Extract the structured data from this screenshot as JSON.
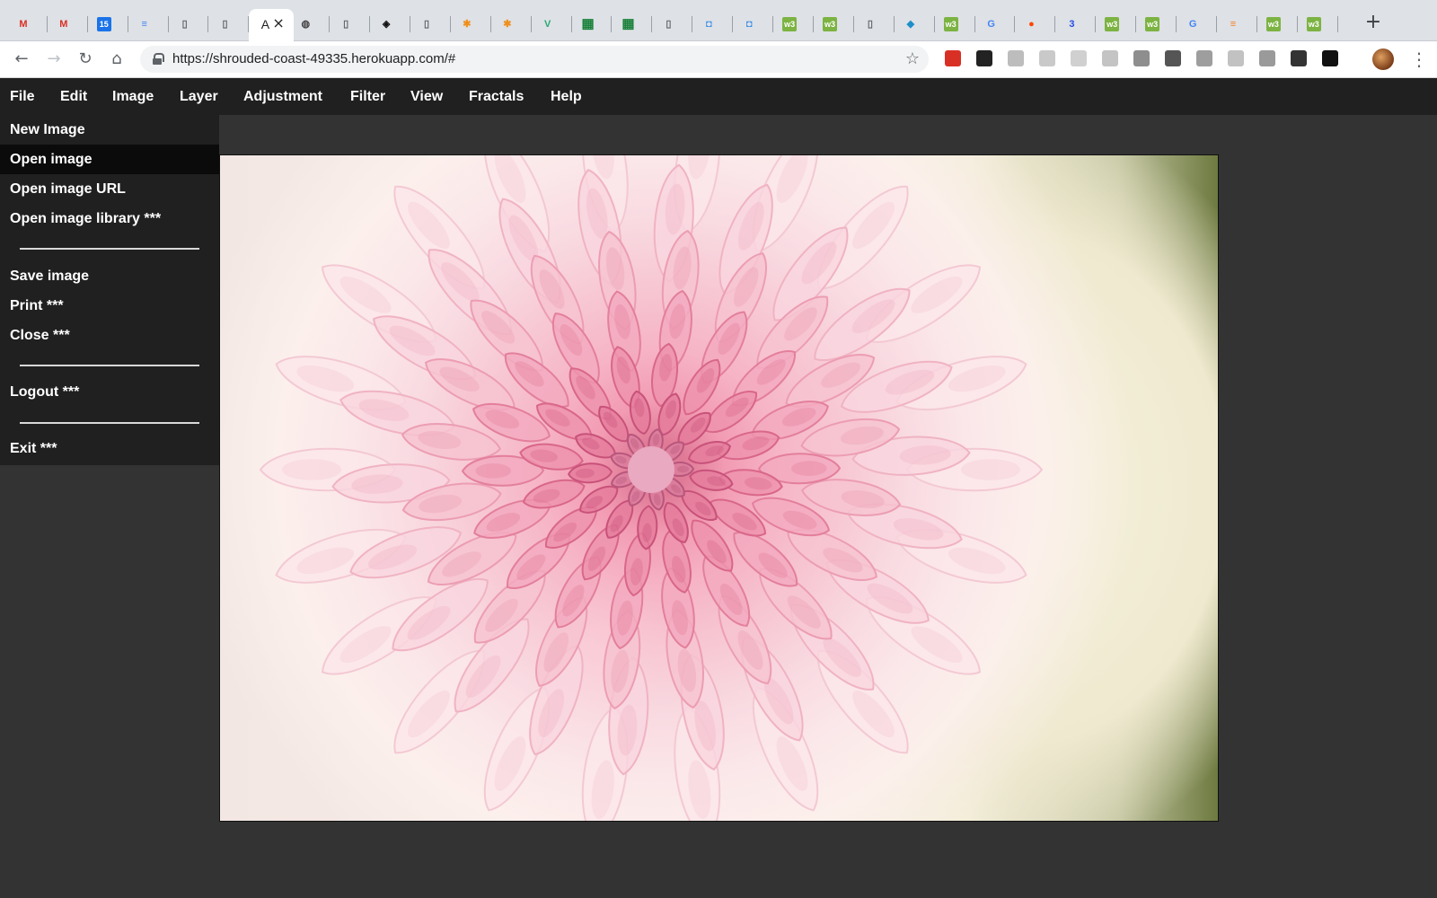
{
  "browser": {
    "tabs": [
      {
        "icon": "gmail-icon",
        "glyph": "M",
        "color": "#d93025"
      },
      {
        "icon": "gmail-icon",
        "glyph": "M",
        "color": "#d93025"
      },
      {
        "icon": "calendar-icon",
        "glyph": "15",
        "color": "#1a73e8"
      },
      {
        "icon": "docs-icon",
        "glyph": "≡",
        "color": "#4285f4"
      },
      {
        "icon": "page-icon",
        "glyph": "▯",
        "color": "#5f6368"
      },
      {
        "icon": "page-icon",
        "glyph": "▯",
        "color": "#5f6368"
      },
      {
        "icon": "active-tab-icon",
        "glyph": "A",
        "color": "#202124"
      },
      {
        "icon": "dribbble-icon",
        "glyph": "◍",
        "color": "#444444"
      },
      {
        "icon": "page-icon",
        "glyph": "▯",
        "color": "#5f6368"
      },
      {
        "icon": "codepen-icon",
        "glyph": "◈",
        "color": "#111111"
      },
      {
        "icon": "page-icon",
        "glyph": "▯",
        "color": "#5f6368"
      },
      {
        "icon": "asterisk-icon",
        "glyph": "✱",
        "color": "#ef8f1c"
      },
      {
        "icon": "asterisk-icon",
        "glyph": "✱",
        "color": "#ef8f1c"
      },
      {
        "icon": "vue-icon",
        "glyph": "V",
        "color": "#2aa872"
      },
      {
        "icon": "sheets-icon",
        "glyph": "▦",
        "color": "#188038"
      },
      {
        "icon": "sheets-icon",
        "glyph": "▦",
        "color": "#188038"
      },
      {
        "icon": "page-icon",
        "glyph": "▯",
        "color": "#5f6368"
      },
      {
        "icon": "shield-icon",
        "glyph": "◘",
        "color": "#3a8ee6"
      },
      {
        "icon": "shield-icon",
        "glyph": "◘",
        "color": "#3a8ee6"
      },
      {
        "icon": "w3-icon",
        "glyph": "w3",
        "color": "#7cb342"
      },
      {
        "icon": "w3-icon",
        "glyph": "w3",
        "color": "#7cb342"
      },
      {
        "icon": "page-icon",
        "glyph": "▯",
        "color": "#5f6368"
      },
      {
        "icon": "bird-icon",
        "glyph": "◆",
        "color": "#1d8fc9"
      },
      {
        "icon": "w3-icon",
        "glyph": "w3",
        "color": "#7cb342"
      },
      {
        "icon": "google-icon",
        "glyph": "G",
        "color": "#4285f4"
      },
      {
        "icon": "reddit-icon",
        "glyph": "●",
        "color": "#ff4500"
      },
      {
        "icon": "css3-icon",
        "glyph": "3",
        "color": "#264de4"
      },
      {
        "icon": "w3-icon",
        "glyph": "w3",
        "color": "#7cb342"
      },
      {
        "icon": "w3-icon",
        "glyph": "w3",
        "color": "#7cb342"
      },
      {
        "icon": "google-icon",
        "glyph": "G",
        "color": "#4285f4"
      },
      {
        "icon": "stackoverflow-icon",
        "glyph": "≡",
        "color": "#f48024"
      },
      {
        "icon": "w3-icon",
        "glyph": "w3",
        "color": "#7cb342"
      },
      {
        "icon": "w3-icon",
        "glyph": "w3",
        "color": "#7cb342"
      }
    ],
    "new_tab_label": "+",
    "url": "https://shrouded-coast-49335.herokuapp.com/#",
    "extensions": [
      {
        "icon": "stop-hand-icon",
        "color": "#d93025"
      },
      {
        "icon": "mask-icon",
        "color": "#222222"
      },
      {
        "icon": "feather-icon",
        "color": "#bdbdbd"
      },
      {
        "icon": "es-icon",
        "color": "#c9c9c9"
      },
      {
        "icon": "grid-icon",
        "color": "#d0d0d0"
      },
      {
        "icon": "box-icon",
        "color": "#c4c4c4"
      },
      {
        "icon": "vue-devtools-icon",
        "color": "#8e8e8e"
      },
      {
        "icon": "bulb-icon",
        "color": "#555555"
      },
      {
        "icon": "shield-ext-icon",
        "color": "#9e9e9e"
      },
      {
        "icon": "print-icon",
        "color": "#c2c2c2"
      },
      {
        "icon": "circle-icon",
        "color": "#9a9a9a"
      },
      {
        "icon": "download-icon",
        "color": "#333333"
      },
      {
        "icon": "shield-dark-icon",
        "color": "#111111"
      }
    ]
  },
  "menubar": {
    "items": [
      "File",
      "Edit",
      "Image",
      "Layer",
      "Adjustment",
      "Filter",
      "View",
      "Fractals",
      "Help"
    ]
  },
  "file_menu": {
    "items": [
      "New Image",
      "Open image",
      "Open image URL",
      "Open image library ***",
      "Save image",
      "Print ***",
      "Close ***",
      "Logout ***",
      "Exit ***"
    ],
    "hovered": "Open image"
  },
  "canvas": {
    "image_subject": "pink dahlia flower"
  }
}
